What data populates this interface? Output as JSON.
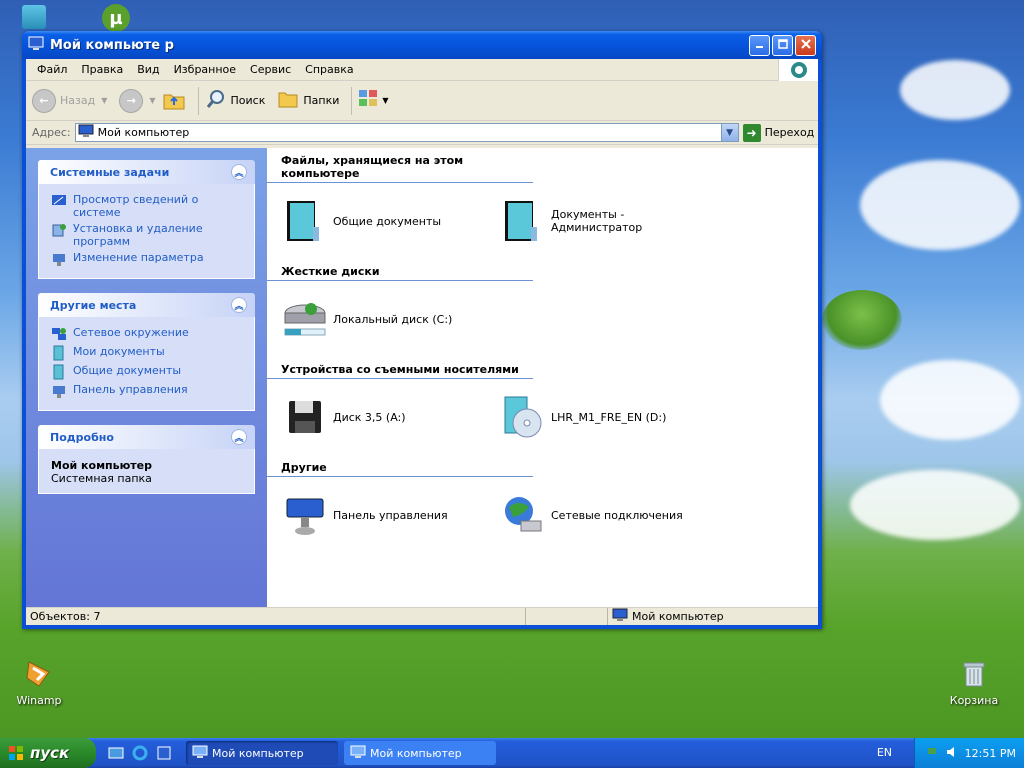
{
  "desktop": {
    "icons": [
      {
        "label": "Winamp"
      },
      {
        "label": "Корзина"
      }
    ]
  },
  "window": {
    "title": "Мой компьюте р",
    "menu": [
      "Файл",
      "Правка",
      "Вид",
      "Избранное",
      "Сервис",
      "Справка"
    ],
    "toolbar": {
      "back": "Назад",
      "search": "Поиск",
      "folders": "Папки"
    },
    "address": {
      "label": "Адрес:",
      "value": "Мой компьютер",
      "go": "Переход"
    },
    "taskpane": {
      "system_tasks": {
        "title": "Системные задачи",
        "items": [
          "Просмотр сведений о системе",
          "Установка и удаление программ",
          "Изменение параметра"
        ]
      },
      "other_places": {
        "title": "Другие места",
        "items": [
          "Сетевое окружение",
          "Мои документы",
          "Общие документы",
          "Панель управления"
        ]
      },
      "details": {
        "title": "Подробно",
        "name": "Мой компьютер",
        "desc": "Системная папка"
      }
    },
    "groups": [
      {
        "title": "Файлы, хранящиеся на этом компьютере",
        "items": [
          "Общие документы",
          "Документы - Администратор"
        ]
      },
      {
        "title": "Жесткие диски",
        "items": [
          "Локальный диск (C:)"
        ]
      },
      {
        "title": "Устройства со съемными носителями",
        "items": [
          "Диск 3,5 (A:)",
          "LHR_M1_FRE_EN (D:)"
        ]
      },
      {
        "title": "Другие",
        "items": [
          "Панель управления",
          "Сетевые подключения"
        ]
      }
    ],
    "status": {
      "objects": "Объектов: 7",
      "location": "Мой компьютер"
    }
  },
  "taskbar": {
    "start": "пуск",
    "tasks": [
      "Мой компьютер",
      "Мой компьютер"
    ],
    "lang": "EN",
    "clock": "12:51 PM"
  },
  "colors": {
    "title_blue": "#0a5fe8",
    "link_blue": "#215dc6",
    "taskpane_bg": "#7ba2e7"
  }
}
